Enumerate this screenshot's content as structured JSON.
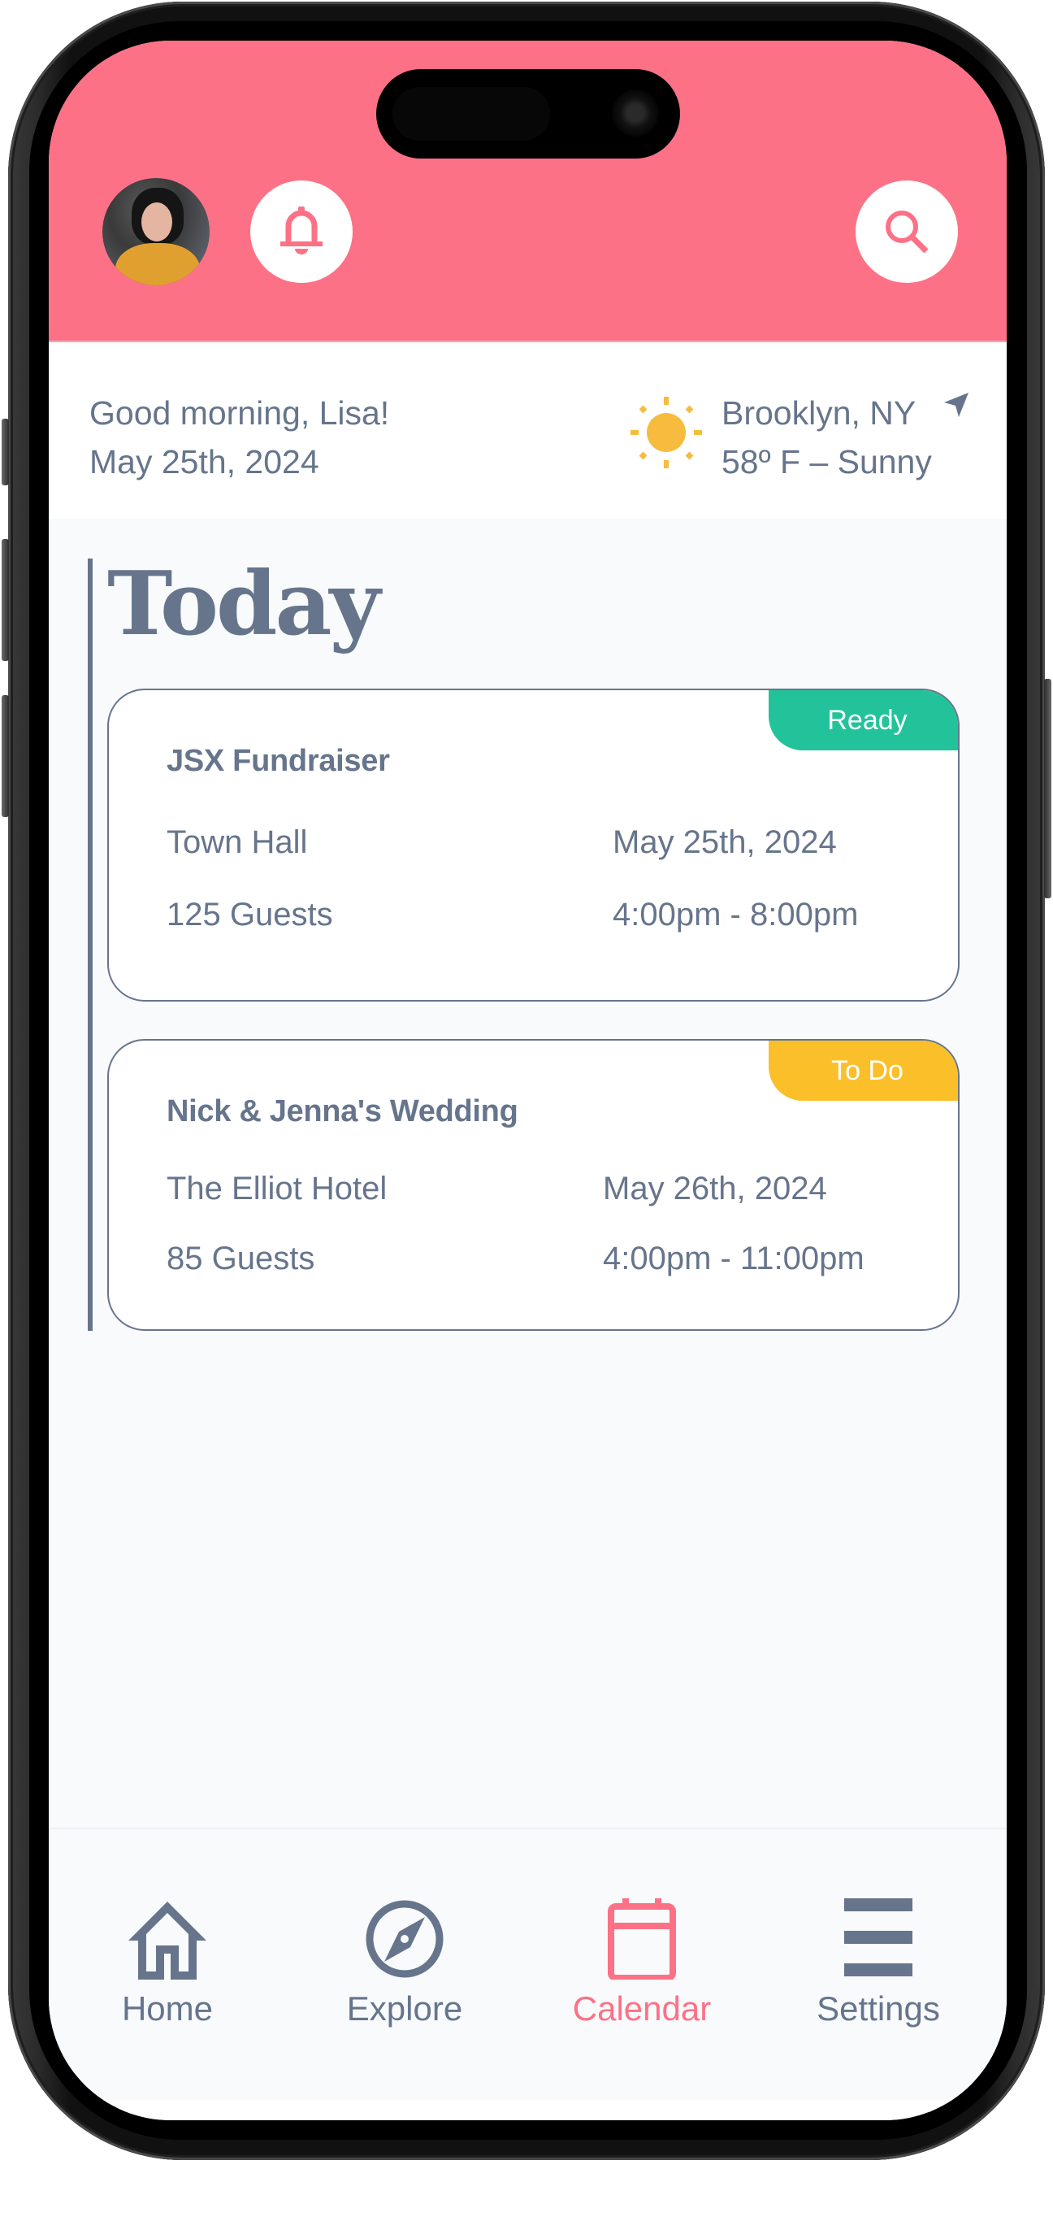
{
  "header": {
    "avatar_alt": "Lisa profile photo",
    "bell_icon": "bell-icon",
    "search_icon": "search-icon"
  },
  "greeting": {
    "line1": "Good morning, Lisa!",
    "line2": "May 25th, 2024"
  },
  "weather": {
    "icon": "sun-icon",
    "location": "Brooklyn, NY",
    "location_icon": "location-arrow-icon",
    "conditions": "58º F – Sunny"
  },
  "main": {
    "section_title": "Today",
    "events": [
      {
        "title": "JSX Fundraiser",
        "status": "Ready",
        "status_color": "#22C39A",
        "venue": "Town Hall",
        "date": "May 25th, 2024",
        "guests": "125 Guests",
        "time": "4:00pm - 8:00pm"
      },
      {
        "title": "Nick & Jenna's Wedding",
        "status": "To Do",
        "status_color": "#FBBF2A",
        "venue": "The Elliot Hotel",
        "date": "May 26th, 2024",
        "guests": "85 Guests",
        "time": "4:00pm - 11:00pm"
      }
    ]
  },
  "nav": {
    "active": "Calendar",
    "items": [
      {
        "label": "Home",
        "icon": "home-icon"
      },
      {
        "label": "Explore",
        "icon": "compass-icon"
      },
      {
        "label": "Calendar",
        "icon": "calendar-icon"
      },
      {
        "label": "Settings",
        "icon": "menu-icon"
      }
    ]
  },
  "colors": {
    "brand": "#FD7186",
    "text": "#66758C",
    "sun": "#F7BC3D",
    "ready": "#22C39A",
    "todo": "#FBBF2A"
  }
}
